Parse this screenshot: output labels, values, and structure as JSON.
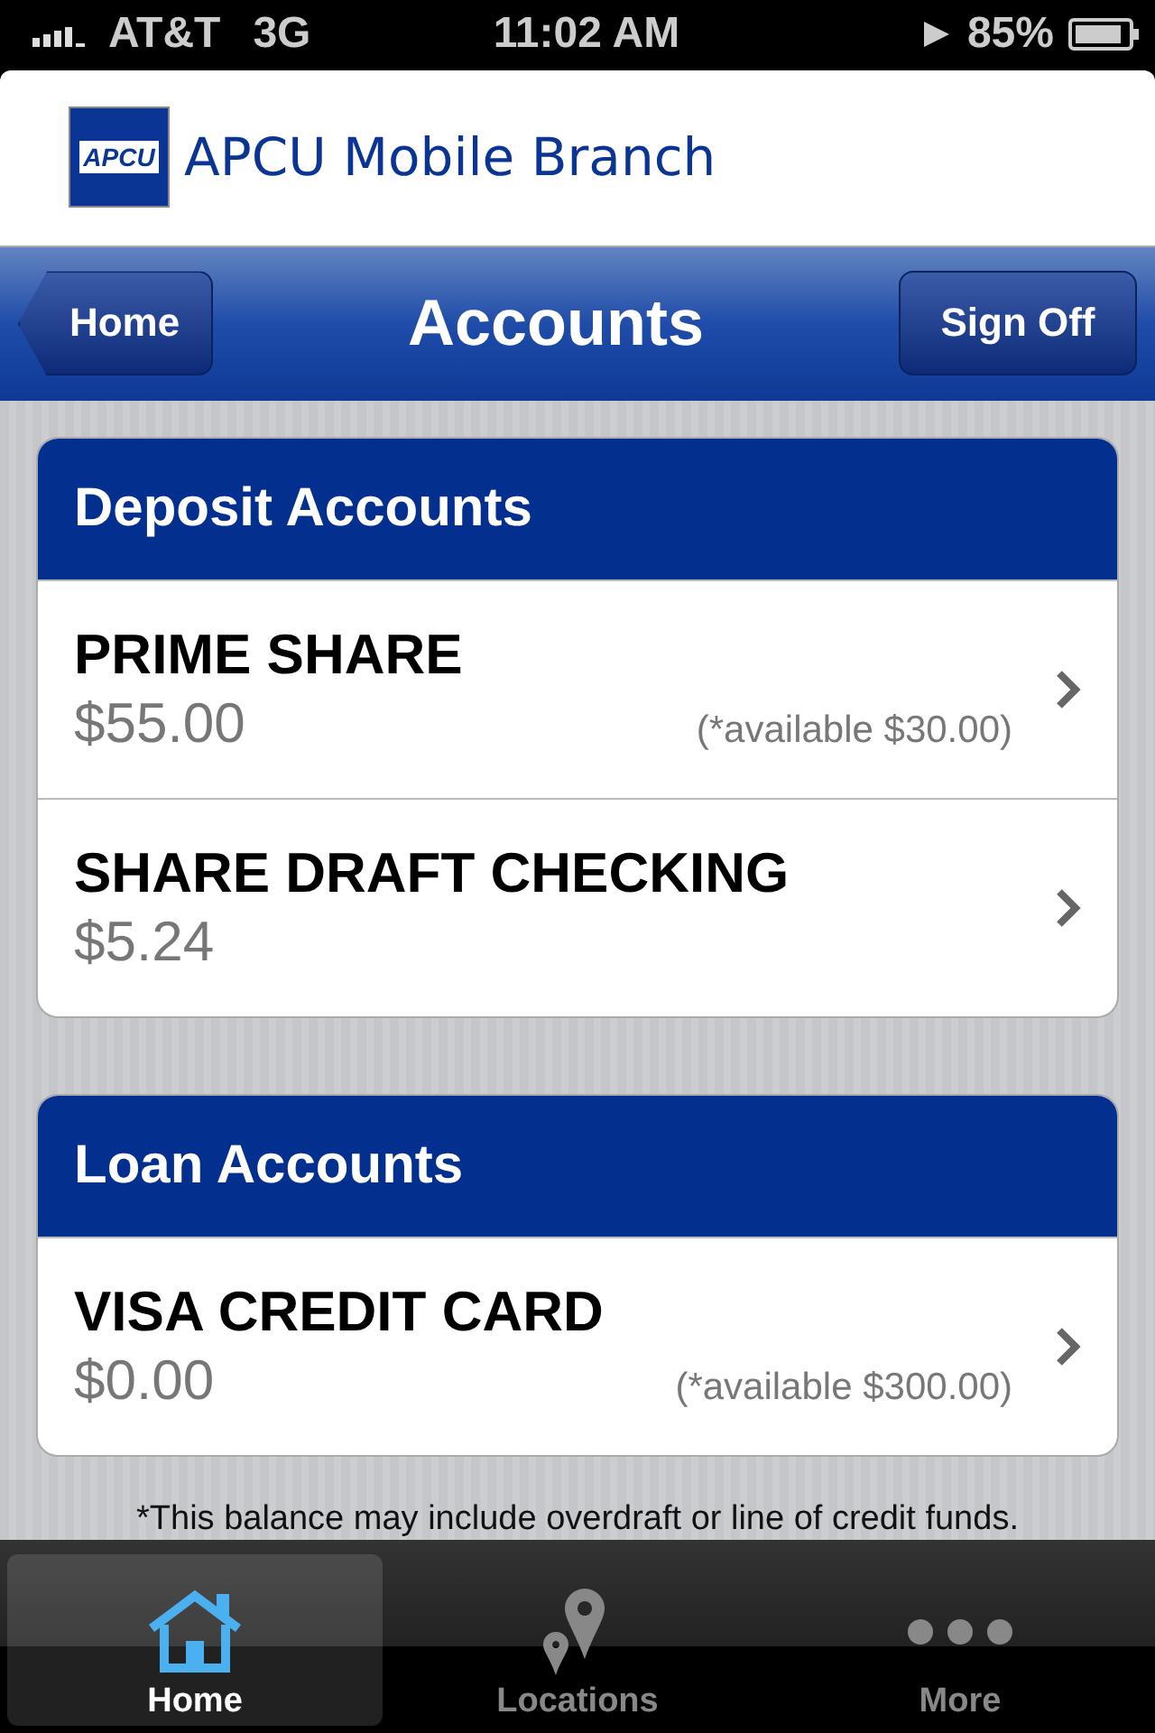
{
  "status_bar": {
    "carrier": "AT&T",
    "network": "3G",
    "time": "11:02 AM",
    "battery": "85%"
  },
  "header": {
    "logo_text": "APCU",
    "title": "APCU Mobile Branch"
  },
  "nav_bar": {
    "back": "Home",
    "title": "Accounts",
    "action": "Sign Off"
  },
  "sections": [
    {
      "title": "Deposit Accounts",
      "accounts": [
        {
          "name": "PRIME SHARE",
          "balance": "$55.00",
          "available": "(*available $30.00)"
        },
        {
          "name": "SHARE DRAFT CHECKING",
          "balance": "$5.24"
        }
      ]
    },
    {
      "title": "Loan Accounts",
      "accounts": [
        {
          "name": "VISA CREDIT CARD",
          "balance": "$0.00",
          "available": "(*available $300.00)"
        }
      ]
    }
  ],
  "footnote": "*This balance may include overdraft or line of credit funds.",
  "tab_bar": [
    {
      "label": "Home",
      "kind": "home",
      "selected": true
    },
    {
      "label": "Locations",
      "kind": "locations",
      "selected": false
    },
    {
      "label": "More",
      "kind": "more",
      "selected": false
    }
  ]
}
